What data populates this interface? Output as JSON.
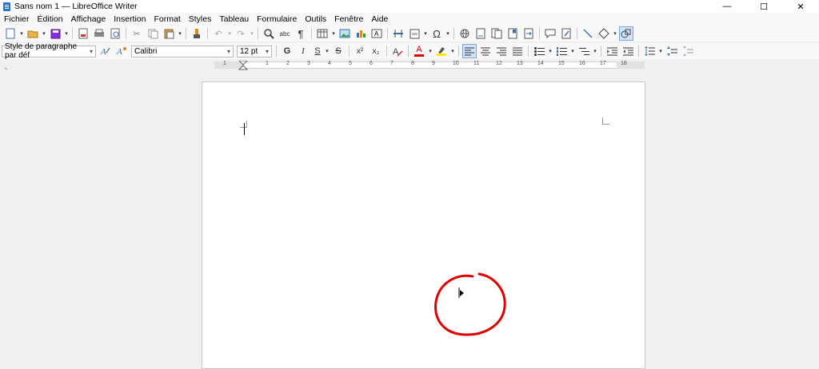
{
  "window": {
    "title": "Sans nom 1 — LibreOffice Writer",
    "min_glyph": "—",
    "max_glyph": "☐",
    "close_glyph": "✕"
  },
  "menu": [
    "Fichier",
    "Édition",
    "Affichage",
    "Insertion",
    "Format",
    "Styles",
    "Tableau",
    "Formulaire",
    "Outils",
    "Fenêtre",
    "Aide"
  ],
  "formatting": {
    "paragraph_style": "Style de paragraphe par déf",
    "font_name": "Calibri",
    "font_size": "12 pt",
    "bold_label": "G",
    "italic_label": "I",
    "underline_label": "S",
    "strike_label": "S",
    "superscript_label": "x²",
    "subscript_label": "x₂",
    "font_color_label": "A",
    "font_color": "#e00000",
    "highlight_color": "#ffe600"
  },
  "ruler": {
    "labels": [
      "1",
      "1",
      "2",
      "3",
      "4",
      "5",
      "6",
      "7",
      "8",
      "9",
      "10",
      "11",
      "12",
      "13",
      "14",
      "15",
      "16",
      "17",
      "18"
    ]
  },
  "annotation": {
    "color": "#e00000"
  }
}
